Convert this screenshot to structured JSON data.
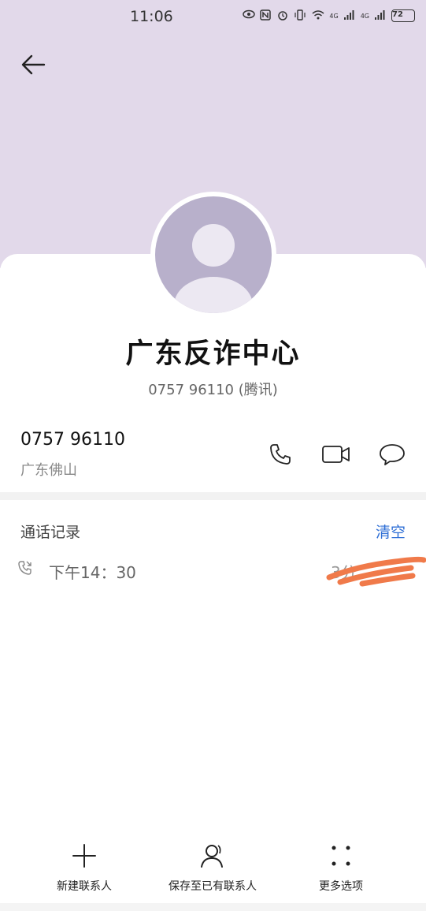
{
  "status_bar": {
    "time": "11:06",
    "network_1": "4G",
    "network_2": "4G",
    "battery": "72"
  },
  "contact": {
    "name": "广东反诈中心",
    "subtitle": "0757 96110 (腾讯)",
    "phone": "0757 96110",
    "location": "广东佛山"
  },
  "call_log": {
    "title": "通话记录",
    "clear_label": "清空",
    "records": [
      {
        "time": "下午14：30",
        "duration": "3分"
      }
    ]
  },
  "bottom_actions": [
    {
      "label": "新建联系人",
      "icon": "plus-icon"
    },
    {
      "label": "保存至已有联系人",
      "icon": "person-icon"
    },
    {
      "label": "更多选项",
      "icon": "more-dots-icon"
    }
  ],
  "colors": {
    "header_bg": "#e2d9ea",
    "avatar_bg": "#b8b0cb",
    "accent": "#2f6fd6",
    "scribble": "#f07a4a"
  }
}
